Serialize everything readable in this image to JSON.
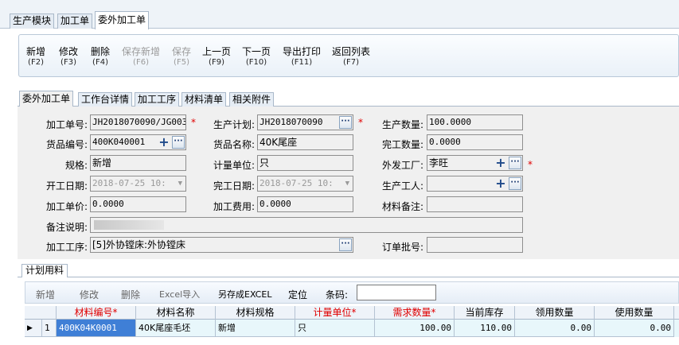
{
  "top_tabs": [
    "生产模块",
    "加工单",
    "委外加工单"
  ],
  "toolbar": [
    {
      "label": "新增",
      "key": "(F2)",
      "enabled": true
    },
    {
      "label": "修改",
      "key": "(F3)",
      "enabled": true
    },
    {
      "label": "删除",
      "key": "(F4)",
      "enabled": true
    },
    {
      "label": "保存新增",
      "key": "(F6)",
      "enabled": false
    },
    {
      "label": "保存",
      "key": "(F5)",
      "enabled": false
    },
    {
      "label": "上一页",
      "key": "(F9)",
      "enabled": true
    },
    {
      "label": "下一页",
      "key": "(F10)",
      "enabled": true
    },
    {
      "label": "导出打印",
      "key": "(F11)",
      "enabled": true
    },
    {
      "label": "返回列表",
      "key": "(F7)",
      "enabled": true
    }
  ],
  "form_tabs": [
    "委外加工单",
    "工作台详情",
    "加工工序",
    "材料清单",
    "相关附件"
  ],
  "form": {
    "order_no_label": "加工单号:",
    "order_no": "JH2018070090/JG003",
    "plan_label": "生产计划:",
    "plan": "JH2018070090",
    "qty_label": "生产数量:",
    "qty": "100.0000",
    "goods_no_label": "货品编号:",
    "goods_no": "400K040001",
    "goods_name_label": "货品名称:",
    "goods_name": "40K尾座",
    "done_qty_label": "完工数量:",
    "done_qty": "0.0000",
    "spec_label": "规格:",
    "spec": "新增",
    "unit_label": "计量单位:",
    "unit": "只",
    "factory_label": "外发工厂:",
    "factory": "李旺",
    "start_label": "开工日期:",
    "start": "2018-07-25 10:",
    "end_label": "完工日期:",
    "end": "2018-07-25 10:",
    "worker_label": "生产工人:",
    "worker": "",
    "price_label": "加工单价:",
    "price": "0.0000",
    "fee_label": "加工费用:",
    "fee": "0.0000",
    "material_note_label": "材料备注:",
    "material_note": "",
    "remark_label": "备注说明:",
    "remark": "",
    "process_label": "加工工序:",
    "process": "[5]外协镗床:外协镗床",
    "batch_label": "订单批号:",
    "batch": ""
  },
  "required_mark": "*",
  "plan_tab": "计划用料",
  "grid_toolbar": {
    "add": "新增",
    "edit": "修改",
    "delete": "删除",
    "import": "Excel导入",
    "export": "另存成EXCEL",
    "locate": "定位",
    "barcode_label": "条码:",
    "barcode": ""
  },
  "grid": {
    "columns": [
      "材料编号*",
      "材料名称",
      "材料规格",
      "计量单位*",
      "需求数量*",
      "当前库存",
      "领用数量",
      "使用数量"
    ],
    "rows": [
      {
        "indicator": "▶",
        "index": "1",
        "code": "400K04K0001",
        "name": "40K尾座毛坯",
        "spec": "新增",
        "unit": "只",
        "demand": "100.00",
        "stock": "110.00",
        "taken": "0.00",
        "used": "0.00"
      }
    ]
  },
  "colors": {
    "required": "#e00000",
    "selection": "#3f7fd6",
    "row_bg": "#e8f7fb"
  }
}
